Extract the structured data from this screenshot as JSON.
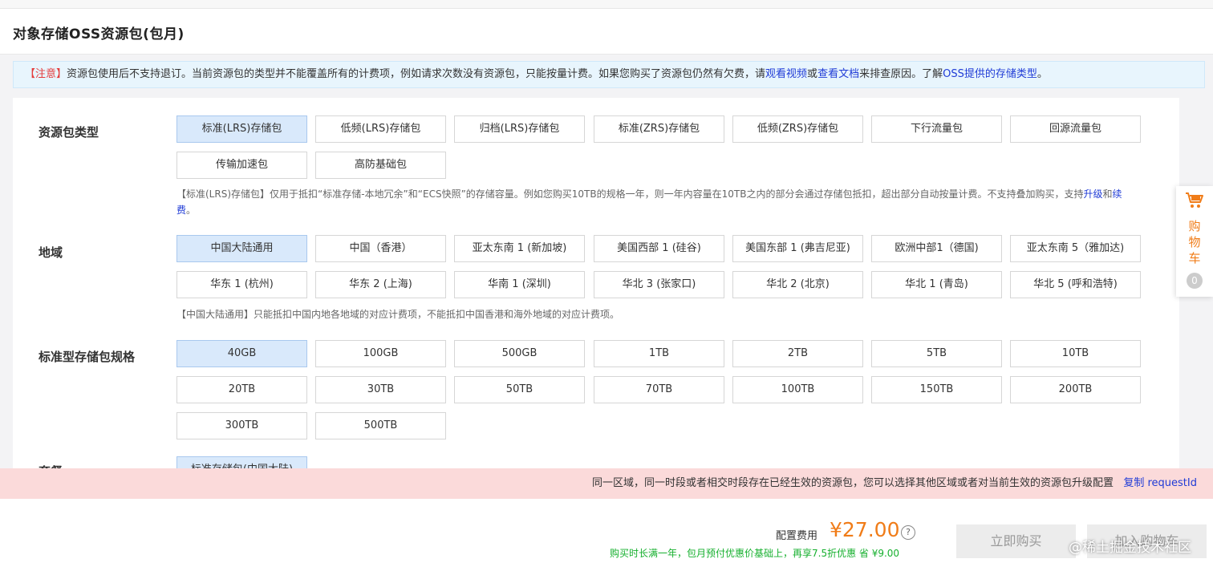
{
  "page": {
    "title": "对象存储OSS资源包(包月)"
  },
  "notice": {
    "tag": "【注意】",
    "text1": "资源包使用后不支持退订。当前资源包的类型并不能覆盖所有的计费项，例如请求次数没有资源包，只能按量计费。如果您购买了资源包仍然有欠费，请",
    "link_video": "观看视频",
    "text2": "或",
    "link_doc": "查看文档",
    "text3": "来排查原因。了解",
    "link_types": "OSS提供的存储类型",
    "text4": "。"
  },
  "sections": {
    "package_type": {
      "label": "资源包类型",
      "options": [
        "标准(LRS)存储包",
        "低频(LRS)存储包",
        "归档(LRS)存储包",
        "标准(ZRS)存储包",
        "低频(ZRS)存储包",
        "下行流量包",
        "回源流量包",
        "传输加速包",
        "高防基础包"
      ],
      "selected": "标准(LRS)存储包",
      "desc_line1": "【标准(LRS)存储包】仅用于抵扣“标准存储-本地冗余”和“ECS快照”的存储容量。例如您购买10TB的规格一年，则一年内容量在10TB之内的部分会通过存储包抵扣，超出部分自动按量计费。不支持叠加购买，支持",
      "desc_link_upgrade": "升级",
      "desc_and": "和",
      "desc_link_renew1": "续",
      "desc_link_renew2": "费",
      "desc_end": "。"
    },
    "region": {
      "label": "地域",
      "options": [
        "中国大陆通用",
        "中国（香港）",
        "亚太东南 1 (新加坡)",
        "美国西部 1 (硅谷)",
        "美国东部 1 (弗吉尼亚)",
        "欧洲中部1（德国)",
        "亚太东南 5（雅加达)",
        "华东 1 (杭州)",
        "华东 2 (上海)",
        "华南 1 (深圳)",
        "华北 3 (张家口)",
        "华北 2 (北京)",
        "华北 1 (青岛)",
        "华北 5 (呼和浩特)"
      ],
      "selected": "中国大陆通用",
      "desc": "【中国大陆通用】只能抵扣中国内地各地域的对应计费项，不能抵扣中国香港和海外地域的对应计费项。"
    },
    "spec": {
      "label": "标准型存储包规格",
      "options": [
        "40GB",
        "100GB",
        "500GB",
        "1TB",
        "2TB",
        "5TB",
        "10TB",
        "20TB",
        "30TB",
        "50TB",
        "70TB",
        "100TB",
        "150TB",
        "200TB",
        "300TB",
        "500TB"
      ],
      "selected": "40GB"
    },
    "partial": {
      "label": "套餐",
      "option": "标准存储包(中国大陆)"
    }
  },
  "cart": {
    "label": "购物车",
    "count": "0",
    "icon": "shopping-cart-icon"
  },
  "error_bar": {
    "message": "同一区域，同一时段或者相交时段存在已经生效的资源包，您可以选择其他区域或者对当前生效的资源包升级配置",
    "copy_link": "复制 requestId"
  },
  "footer": {
    "fee_label": "配置费用",
    "price": "¥27.00",
    "help_icon": "?",
    "promo": "购买时长满一年，包月预付优惠价基础上，再享7.5折优惠 省 ¥9.00",
    "buy_now": "立即购买",
    "add_cart": "加入购物车",
    "watermark": "@稀土掘金技术社区"
  },
  "colors": {
    "accent_orange": "#f07c18",
    "link_blue": "#1f3bd6",
    "selected_bg": "#d9e9fb",
    "error_bg": "#fbdada",
    "promo_green": "#17b02f"
  }
}
